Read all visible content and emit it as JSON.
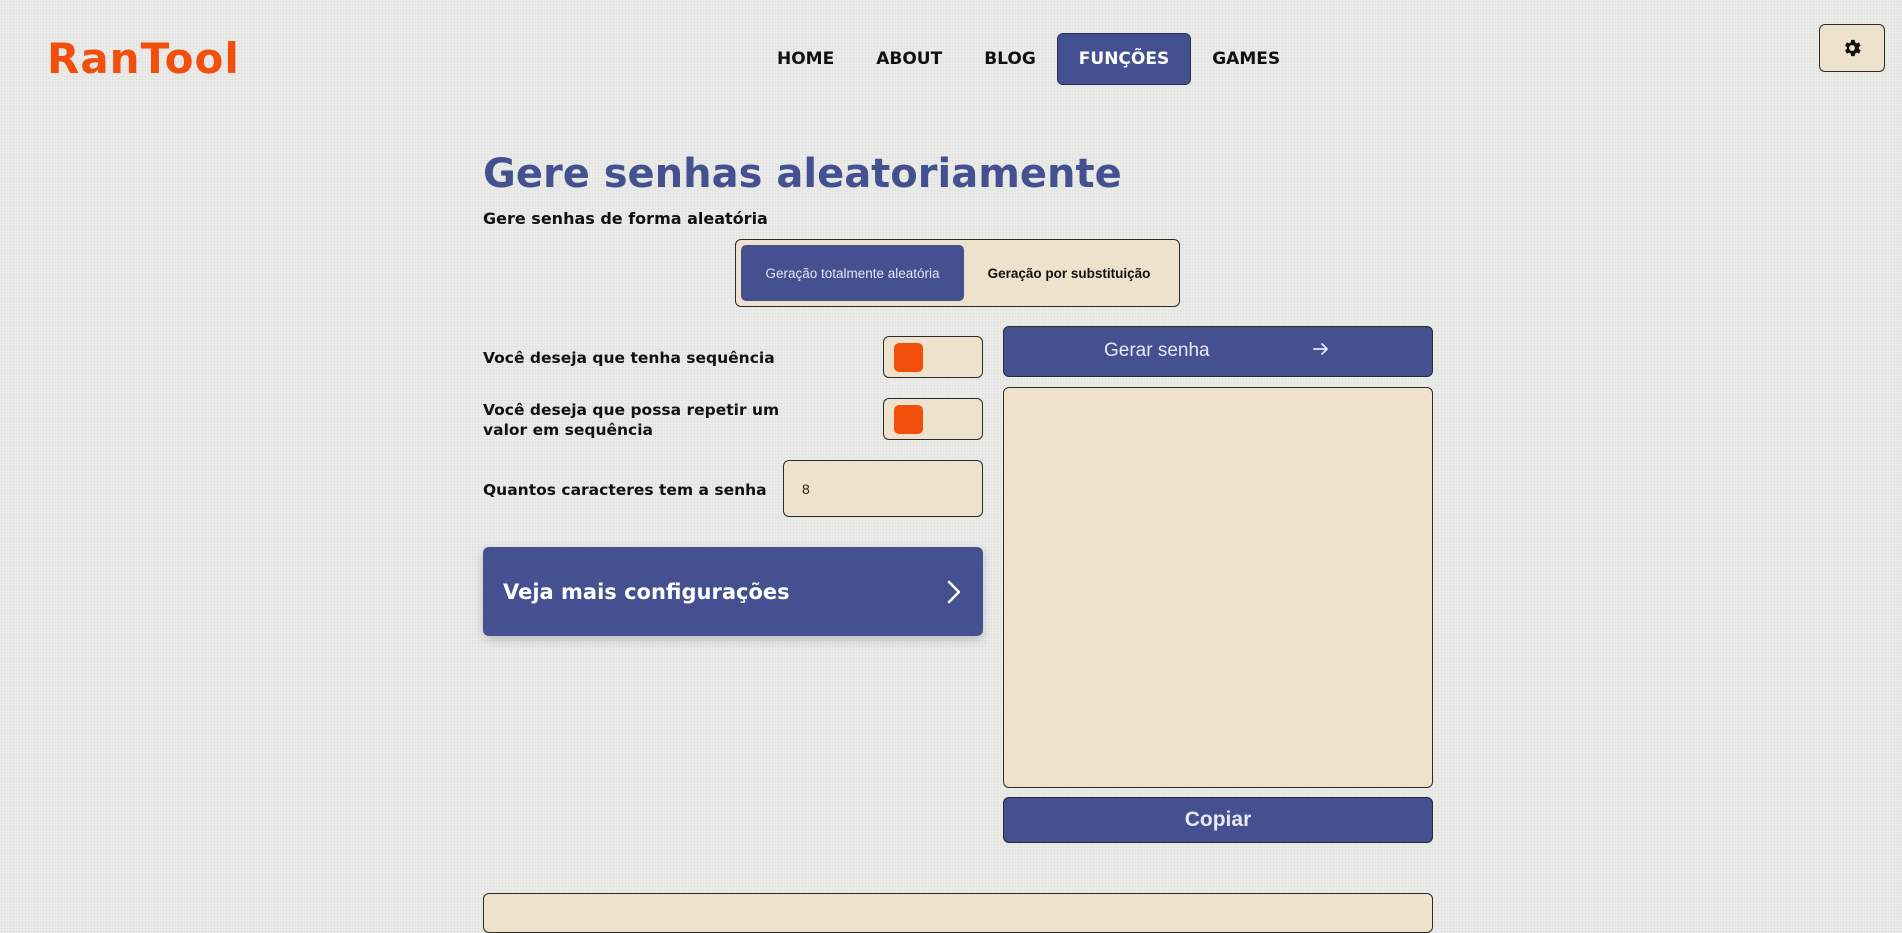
{
  "app": {
    "logo": "RanTool"
  },
  "nav": {
    "items": [
      {
        "label": "HOME"
      },
      {
        "label": "ABOUT"
      },
      {
        "label": "BLOG"
      },
      {
        "label": "FUNÇÕES",
        "active": true
      },
      {
        "label": "GAMES"
      }
    ]
  },
  "settings": {
    "icon": "gear-icon"
  },
  "page": {
    "title": "Gere senhas aleatoriamente",
    "subtitle": "Gere senhas de forma aleatória"
  },
  "mode": {
    "options": [
      {
        "label": "Geração totalmente aleatória",
        "active": true
      },
      {
        "label": "Geração por substituição",
        "active": false
      }
    ]
  },
  "options": {
    "sequence_label": "Você deseja que tenha sequência",
    "repeat_label_line1": "Você deseja que possa repetir um",
    "repeat_label_line2": "valor em sequência",
    "length_label": "Quantos caracteres tem a senha",
    "length_value": "8",
    "sequence_enabled": false,
    "repeat_enabled": false
  },
  "more_config": {
    "label": "Veja mais configurações",
    "icon": "chevron-right-icon"
  },
  "generator": {
    "generate_label": "Gerar senha",
    "generate_icon": "arrow-right-icon",
    "output": "",
    "copy_label": "Copiar"
  },
  "colors": {
    "accent": "#44508f",
    "brand": "#f24e0c",
    "panel": "#efe2cc",
    "background": "#ebebea"
  }
}
